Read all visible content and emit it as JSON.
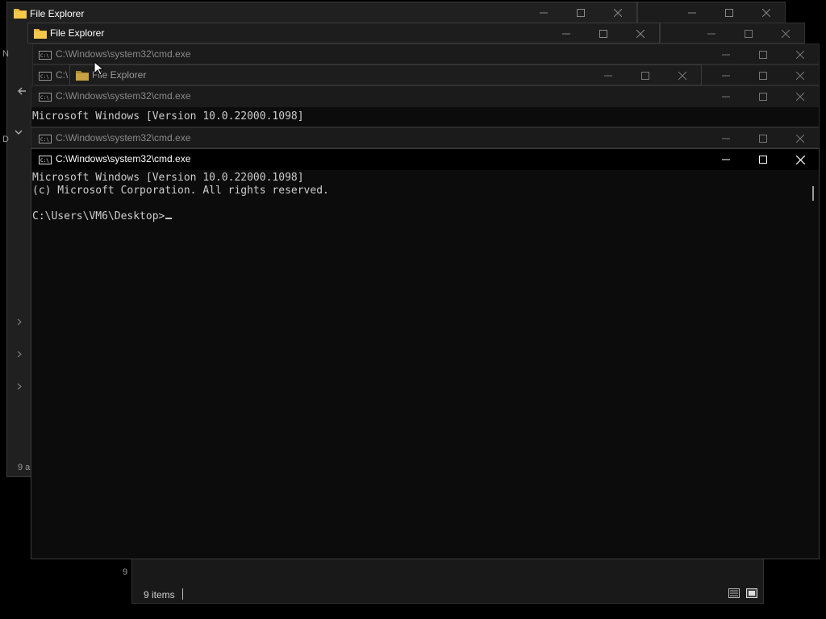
{
  "windows": {
    "explorer_1": {
      "title": "File Explorer"
    },
    "explorer_2": {
      "title": "File Explorer"
    },
    "explorer_3": {
      "title": "File Explorer"
    },
    "cmd_a": {
      "title": "C:\\Windows\\system32\\cmd.exe"
    },
    "cmd_b": {
      "title": "C:\\"
    },
    "cmd_c": {
      "title": "C:\\Windows\\system32\\cmd.exe",
      "line1": "Microsoft Windows [Version 10.0.22000.1098]"
    },
    "cmd_d": {
      "title": "C:\\Windows\\system32\\cmd.exe"
    },
    "cmd_main": {
      "title": "C:\\Windows\\system32\\cmd.exe",
      "lines": [
        "Microsoft Windows [Version 10.0.22000.1098]",
        "(c) Microsoft Corporation. All rights reserved.",
        "",
        "C:\\Users\\VM6\\Desktop>"
      ]
    }
  },
  "status_bar": {
    "items_count": "9 items"
  },
  "explorer_side": {
    "letter_n": "N",
    "letter_d": "D",
    "count_a": "9 a",
    "count_b": "9"
  },
  "colors": {
    "folder": "#e8b63a",
    "console_text": "#cccccc",
    "background": "#000000"
  },
  "icons": [
    "folder-icon",
    "cmd-icon",
    "minimize-icon",
    "maximize-icon",
    "close-icon",
    "back-arrow-icon",
    "chevron-down-icon",
    "chevron-right-icon",
    "details-view-icon",
    "tiles-view-icon"
  ]
}
